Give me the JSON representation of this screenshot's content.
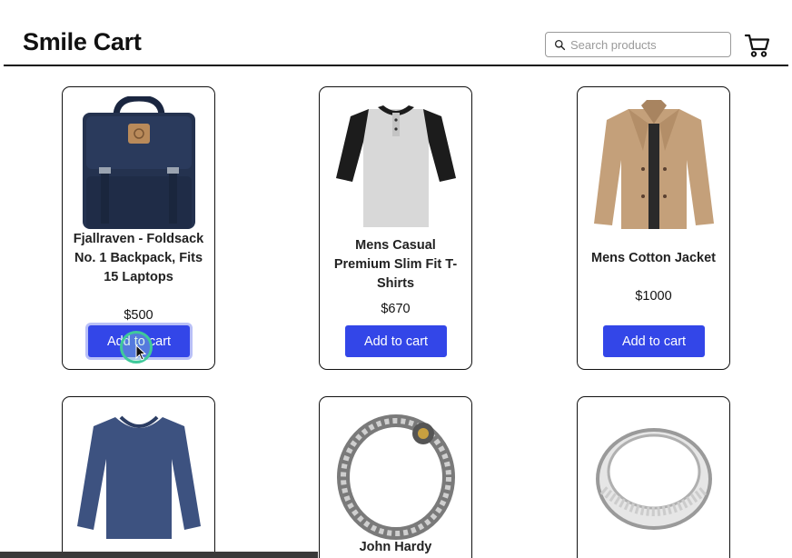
{
  "header": {
    "brand": "Smile Cart",
    "search": {
      "placeholder": "Search products",
      "value": ""
    },
    "cart_icon": "shopping-cart-icon"
  },
  "products": [
    {
      "title": "Fjallraven - Foldsack No. 1 Backpack, Fits 15 Laptops",
      "price": "$500",
      "button": "Add to cart",
      "image": "backpack-image"
    },
    {
      "title": "Mens Casual Premium Slim Fit T-Shirts",
      "price": "$670",
      "button": "Add to cart",
      "image": "tshirt-image"
    },
    {
      "title": "Mens Cotton Jacket",
      "price": "$1000",
      "button": "Add to cart",
      "image": "jacket-image"
    },
    {
      "title": "",
      "price": "",
      "button": "",
      "image": "longsleeve-shirt-image"
    },
    {
      "title": "John Hardy",
      "price": "",
      "button": "",
      "image": "bracelet-image"
    },
    {
      "title": "",
      "price": "",
      "button": "",
      "image": "ring-image"
    }
  ],
  "colors": {
    "accent": "#3346e8",
    "text": "#111111",
    "border": "#111111"
  }
}
